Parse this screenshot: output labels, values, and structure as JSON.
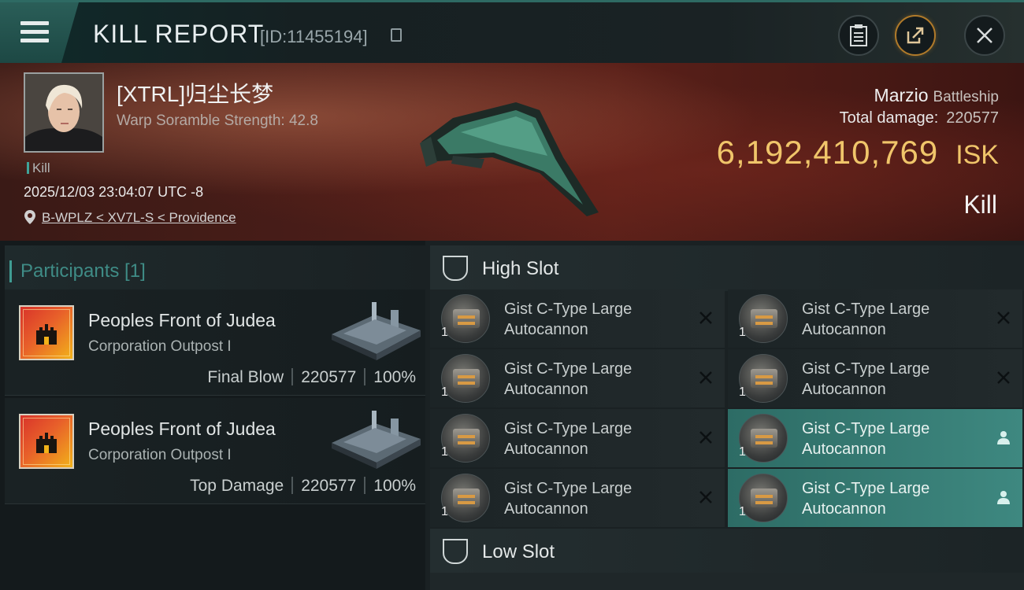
{
  "header": {
    "title": "KILL REPORT",
    "report_id": "[ID:11455194]"
  },
  "victim": {
    "pilot": "[XTRL]归尘长梦",
    "warp_scramble": "Warp Soramble Strength: 42.8",
    "type_tag": "Kill",
    "datetime": "2025/12/03 23:04:07 UTC -8",
    "location": "B-WPLZ < XV7L-S < Providence",
    "ship_name": "Marzio",
    "ship_class": "Battleship",
    "total_damage_label": "Total damage:",
    "total_damage": "220577",
    "isk_value": "6,192,410,769",
    "isk_unit": "ISK",
    "result": "Kill"
  },
  "participants": {
    "header": "Participants [1]",
    "items": [
      {
        "name": "Peoples Front of Judea",
        "sub": "Corporation Outpost I",
        "role": "Final Blow",
        "damage": "220577",
        "percent": "100%"
      },
      {
        "name": "Peoples Front of Judea",
        "sub": "Corporation Outpost I",
        "role": "Top Damage",
        "damage": "220577",
        "percent": "100%"
      }
    ]
  },
  "slots": {
    "high": {
      "label": "High Slot",
      "modules": [
        {
          "name": "Gist C-Type Large Autocannon",
          "qty": "1",
          "state": "destroyed"
        },
        {
          "name": "Gist C-Type Large Autocannon",
          "qty": "1",
          "state": "destroyed"
        },
        {
          "name": "Gist C-Type Large Autocannon",
          "qty": "1",
          "state": "destroyed"
        },
        {
          "name": "Gist C-Type Large Autocannon",
          "qty": "1",
          "state": "destroyed"
        },
        {
          "name": "Gist C-Type Large Autocannon",
          "qty": "1",
          "state": "destroyed"
        },
        {
          "name": "Gist C-Type Large Autocannon",
          "qty": "1",
          "state": "dropped"
        },
        {
          "name": "Gist C-Type Large Autocannon",
          "qty": "1",
          "state": "destroyed"
        },
        {
          "name": "Gist C-Type Large Autocannon",
          "qty": "1",
          "state": "dropped"
        }
      ]
    },
    "low": {
      "label": "Low Slot"
    }
  },
  "colors": {
    "accent": "#3f9c93",
    "isk": "#f0c56a",
    "dropped": "#2d6c65"
  },
  "icons": [
    "menu-icon",
    "copy-icon",
    "clipboard-icon",
    "share-icon",
    "close-icon",
    "location-pin-icon",
    "slot-icon",
    "destroyed-x-icon",
    "dropped-person-icon"
  ]
}
